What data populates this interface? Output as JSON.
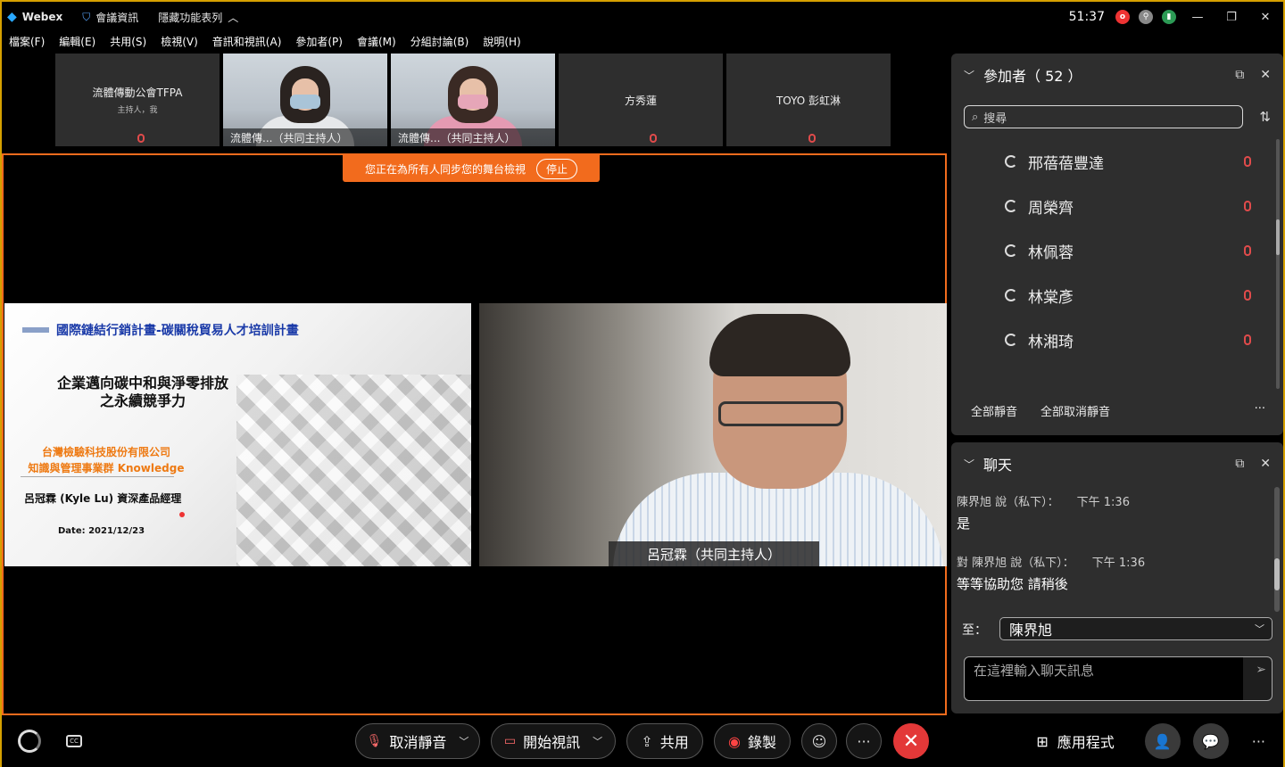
{
  "titlebar": {
    "app_name": "Webex",
    "meeting_info": "會議資訊",
    "hide_menu": "隱藏功能表列",
    "timer": "51:37",
    "minimize": "—",
    "restore": "❐",
    "close": "✕"
  },
  "menubar": [
    "檔案(F)",
    "編輯(E)",
    "共用(S)",
    "檢視(V)",
    "音訊和視訊(A)",
    "參加者(P)",
    "會議(M)",
    "分組討論(B)",
    "說明(H)"
  ],
  "thumbnails": [
    {
      "name": "流體傳動公會TFPA",
      "subtitle": "主持人，我"
    },
    {
      "caption": "流體傳...（共同主持人）"
    },
    {
      "caption": "流體傳...（共同主持人）"
    },
    {
      "name": "方秀蓮"
    },
    {
      "name": "TOYO 彭虹淋"
    }
  ],
  "stage": {
    "sync_banner": "您正在為所有人同步您的舞台檢視",
    "sync_stop": "停止",
    "slide": {
      "header": "國際鏈結行銷計畫-碳關稅貿易人才培訓計畫",
      "title_line1": "企業邁向碳中和與淨零排放",
      "title_line2": "之永續競爭力",
      "company_line1": "台灣檢驗科技股份有限公司",
      "company_line2": "知識與管理事業群 Knowledge",
      "presenter": "呂冠霖 (Kyle Lu) 資深產品經理",
      "date": "Date: 2021/12/23"
    },
    "speaker_caption": "呂冠霖（共同主持人）"
  },
  "participants": {
    "title": "參加者（ 52 ）",
    "search_placeholder": "搜尋",
    "list": [
      "邢蓓蓓豐達",
      "周榮齊",
      "林佩蓉",
      "林棠彥",
      "林湘琦"
    ],
    "mute_all": "全部靜音",
    "unmute_all": "全部取消靜音",
    "more": "···"
  },
  "chat": {
    "title": "聊天",
    "messages": [
      {
        "meta": "陳界旭 說（私下）：",
        "time": "下午 1:36",
        "text": "是"
      },
      {
        "meta": "對 陳界旭 說（私下）：",
        "time": "下午 1:36",
        "text": "等等協助您 請稍後"
      }
    ],
    "to_label": "至：",
    "to_value": "陳界旭",
    "input_placeholder": "在這裡輸入聊天訊息"
  },
  "bottombar": {
    "unmute": "取消靜音",
    "start_video": "開始視訊",
    "share": "共用",
    "record": "錄製",
    "more": "···",
    "apps": "應用程式"
  },
  "colors": {
    "accent": "#f26b1d",
    "leave": "#e33838",
    "muted": "#e04b4b",
    "window_border": "#d6a000"
  }
}
